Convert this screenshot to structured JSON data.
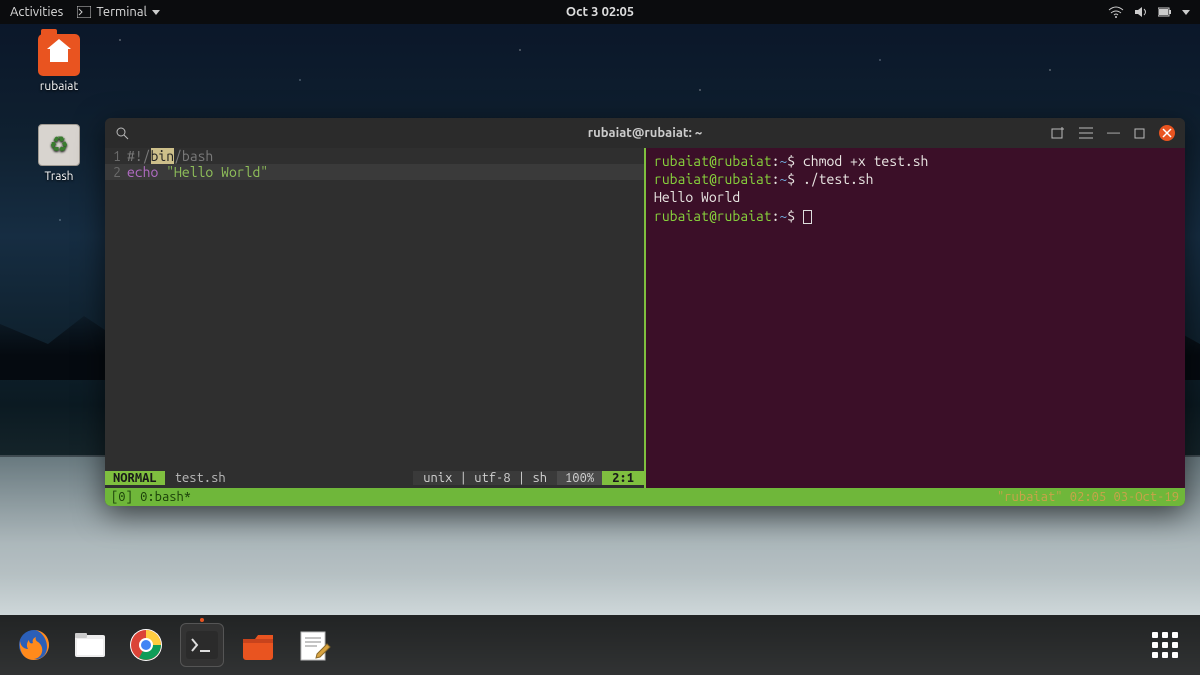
{
  "topbar": {
    "activities": "Activities",
    "app_menu": "Terminal",
    "datetime": "Oct 3  02:05"
  },
  "desktop": {
    "home_folder": "rubaiat",
    "trash": "Trash"
  },
  "window": {
    "title": "rubaiat@rubaiat: ~"
  },
  "editor": {
    "lines": [
      {
        "n": "1",
        "pre": "#!/",
        "hl": "bin",
        "post": "/bash"
      },
      {
        "n": "2",
        "kw": "echo",
        "str": "\"Hello World\""
      }
    ],
    "status": {
      "mode": "NORMAL",
      "file": "test.sh",
      "meta": "unix | utf-8 | sh",
      "percent": "100%",
      "pos": "2:1"
    }
  },
  "tmux": {
    "left": "[0] 0:bash*",
    "right": "\"rubaiat\" 02:05 03-Oct-19"
  },
  "shell": {
    "prompt_user": "rubaiat@rubaiat",
    "prompt_path": "~",
    "lines": [
      {
        "type": "cmd",
        "text": "chmod +x test.sh"
      },
      {
        "type": "cmd",
        "text": "./test.sh"
      },
      {
        "type": "out",
        "text": "Hello World"
      },
      {
        "type": "cmd",
        "text": ""
      }
    ]
  },
  "dock": {
    "apps": [
      "firefox",
      "files",
      "chrome",
      "terminal",
      "file-manager",
      "text-editor"
    ]
  }
}
